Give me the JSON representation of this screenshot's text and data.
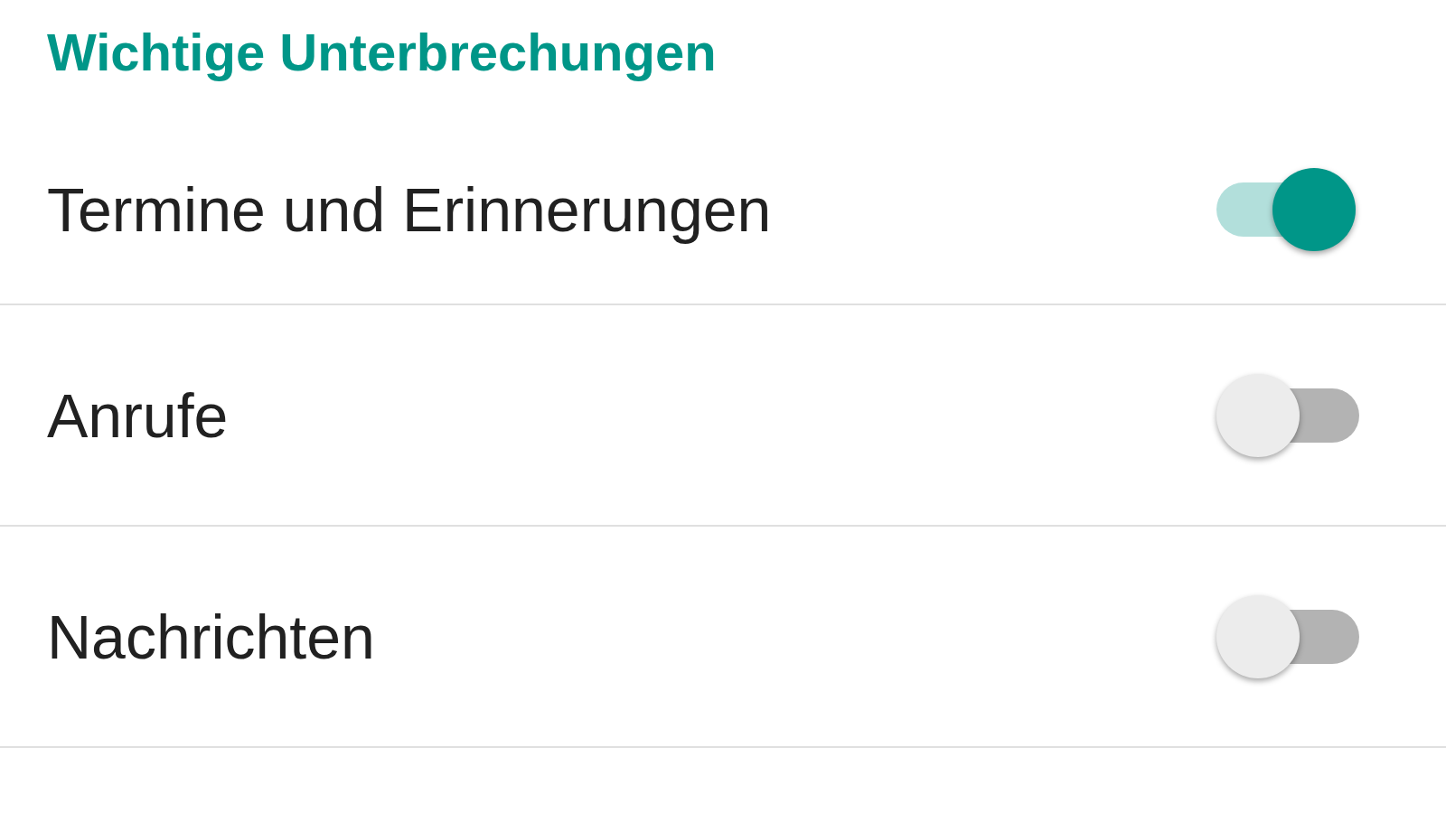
{
  "section": {
    "title": "Wichtige Unterbrechungen"
  },
  "settings": [
    {
      "label": "Termine und Erinnerungen",
      "on": true
    },
    {
      "label": "Anrufe",
      "on": false
    },
    {
      "label": "Nachrichten",
      "on": false
    }
  ]
}
